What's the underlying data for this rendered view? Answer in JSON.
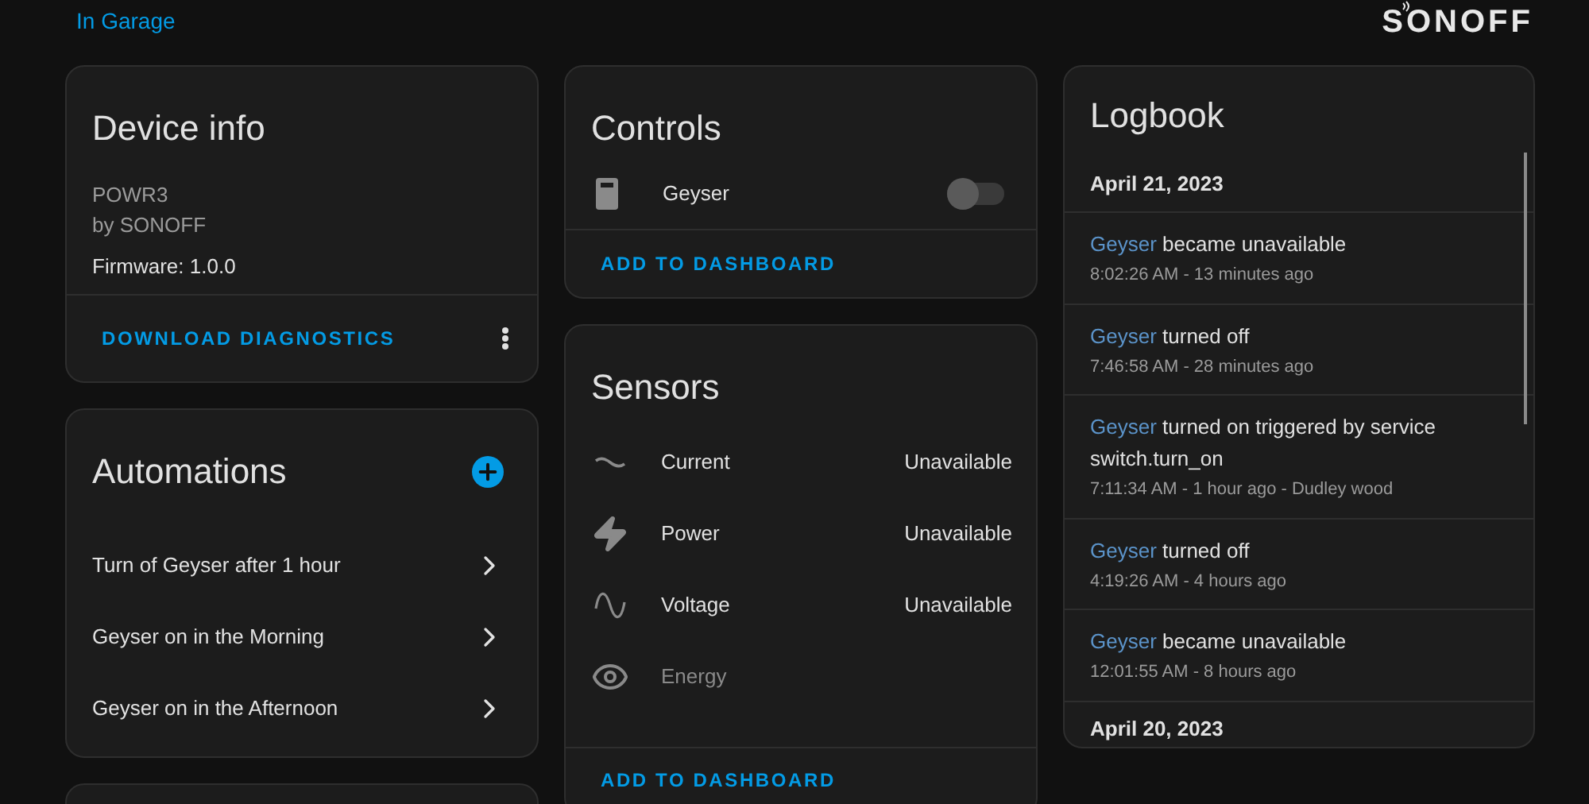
{
  "header": {
    "area_link": "In Garage",
    "logo": "SONOFF"
  },
  "device_info": {
    "title": "Device info",
    "model": "POWR3",
    "manufacturer": "by SONOFF",
    "firmware": "Firmware: 1.0.0",
    "action": "DOWNLOAD DIAGNOSTICS"
  },
  "automations": {
    "title": "Automations",
    "items": [
      {
        "label": "Turn of Geyser after 1 hour"
      },
      {
        "label": "Geyser on in the Morning"
      },
      {
        "label": "Geyser on in the Afternoon"
      }
    ]
  },
  "controls": {
    "title": "Controls",
    "items": [
      {
        "kind": "switch",
        "name": "Geyser",
        "on": false
      }
    ],
    "action": "ADD TO DASHBOARD"
  },
  "sensors": {
    "title": "Sensors",
    "items": [
      {
        "kind": "current",
        "name": "Current",
        "value": "Unavailable",
        "disabled": false
      },
      {
        "kind": "power",
        "name": "Power",
        "value": "Unavailable",
        "disabled": false
      },
      {
        "kind": "voltage",
        "name": "Voltage",
        "value": "Unavailable",
        "disabled": false
      },
      {
        "kind": "energy",
        "name": "Energy",
        "disabled": true
      }
    ],
    "action": "ADD TO DASHBOARD"
  },
  "logbook": {
    "title": "Logbook",
    "groups": [
      {
        "date": "April 21, 2023",
        "entries": [
          {
            "entity": "Geyser",
            "message": "became unavailable",
            "meta": "8:02:26 AM - 13 minutes ago"
          },
          {
            "entity": "Geyser",
            "message": "turned off",
            "meta": "7:46:58 AM - 28 minutes ago"
          },
          {
            "entity": "Geyser",
            "message": "turned on triggered by service switch.turn_on",
            "meta": "7:11:34 AM - 1 hour ago - Dudley wood"
          },
          {
            "entity": "Geyser",
            "message": "turned off",
            "meta": "4:19:26 AM - 4 hours ago"
          },
          {
            "entity": "Geyser",
            "message": "became unavailable",
            "meta": "12:01:55 AM - 8 hours ago"
          }
        ]
      },
      {
        "date": "April 20, 2023"
      }
    ]
  }
}
